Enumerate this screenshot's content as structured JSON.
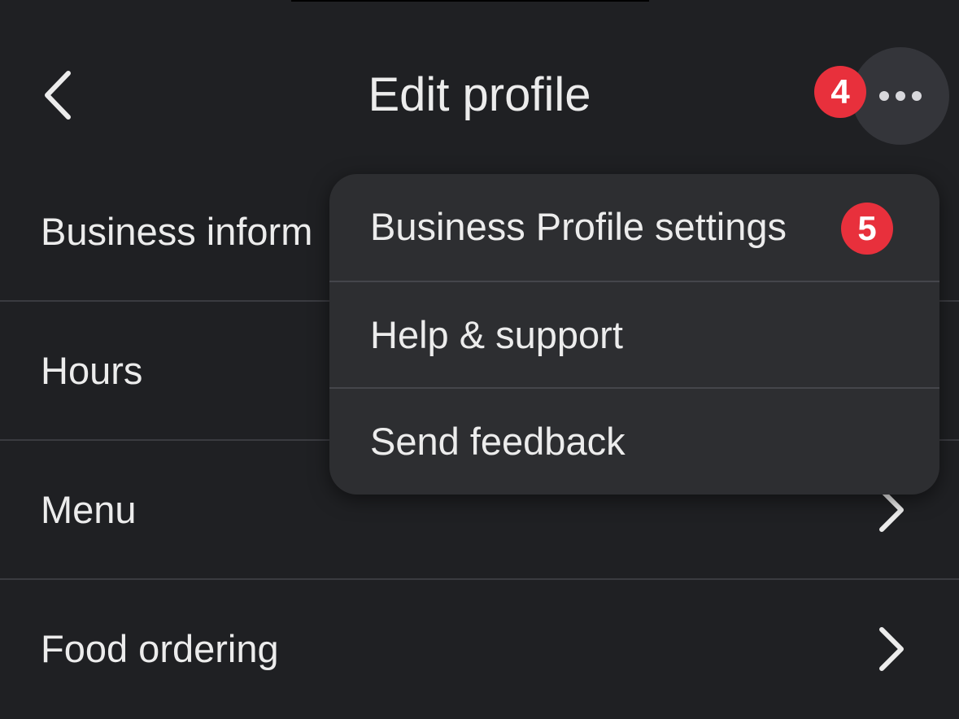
{
  "header": {
    "title": "Edit profile",
    "back_icon": "chevron-left-icon",
    "more_icon": "more-horizontal-icon",
    "more_badge": "4"
  },
  "list": {
    "items": [
      {
        "label": "Business inform",
        "chevron": "chevron-right-icon"
      },
      {
        "label": "Hours",
        "chevron": "chevron-right-icon"
      },
      {
        "label": "Menu",
        "chevron": "chevron-right-icon"
      },
      {
        "label": "Food ordering",
        "chevron": "chevron-right-icon"
      }
    ]
  },
  "menu": {
    "items": [
      {
        "label": "Business Profile settings",
        "badge": "5"
      },
      {
        "label": "Help & support"
      },
      {
        "label": "Send feedback"
      }
    ]
  },
  "colors": {
    "background": "#1f2023",
    "menu_background": "#2d2e31",
    "badge": "#e8303c",
    "text": "#ececec",
    "divider": "#3a3b40"
  }
}
